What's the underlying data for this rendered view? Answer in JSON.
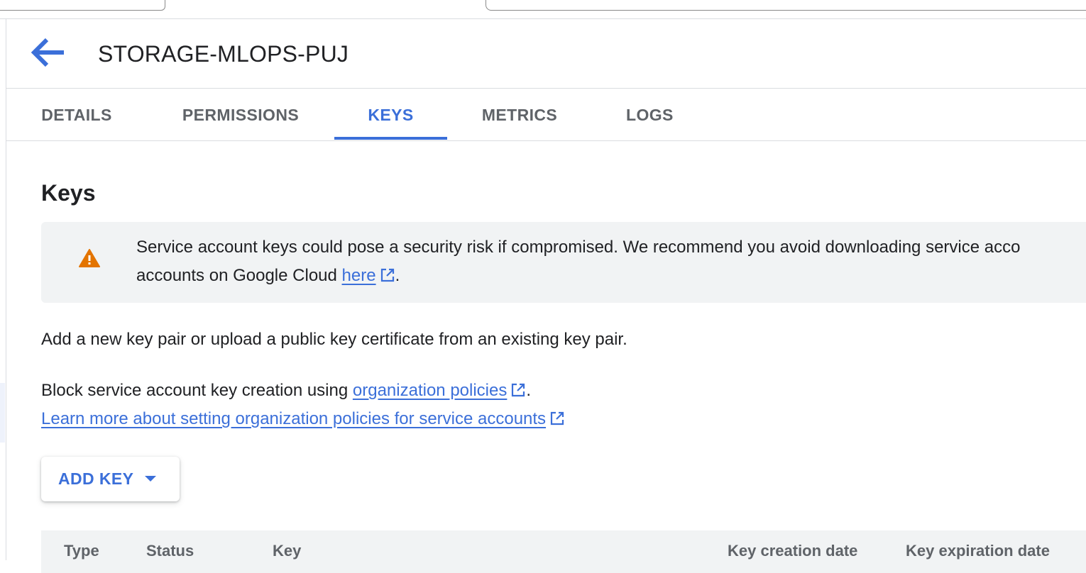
{
  "page": {
    "title": "STORAGE-MLOPS-PUJ",
    "back_icon": "arrow-back-icon"
  },
  "tabs": [
    {
      "label": "DETAILS",
      "active": false
    },
    {
      "label": "PERMISSIONS",
      "active": false
    },
    {
      "label": "KEYS",
      "active": true
    },
    {
      "label": "METRICS",
      "active": false
    },
    {
      "label": "LOGS",
      "active": false
    }
  ],
  "section": {
    "title": "Keys"
  },
  "warning": {
    "icon": "warning-icon",
    "line1": "Service account keys could pose a security risk if compromised. We recommend you avoid downloading service acco",
    "line2_prefix": "accounts on Google Cloud ",
    "link_text": "here",
    "line2_suffix": "."
  },
  "description": "Add a new key pair or upload a public key certificate from an existing key pair.",
  "block_policy": {
    "prefix": "Block service account key creation using ",
    "link_text": "organization policies",
    "suffix": "."
  },
  "learn_more_link": "Learn more about setting organization policies for service accounts",
  "add_key_button": {
    "label": "ADD KEY",
    "icon": "caret-down-icon"
  },
  "table": {
    "columns": [
      "Type",
      "Status",
      "Key",
      "Key creation date",
      "Key expiration date"
    ]
  },
  "colors": {
    "accent": "#3b6fd9",
    "warning": "#e37400",
    "text": "#202124",
    "muted": "#5f6368",
    "panel_bg": "#f1f3f4"
  }
}
